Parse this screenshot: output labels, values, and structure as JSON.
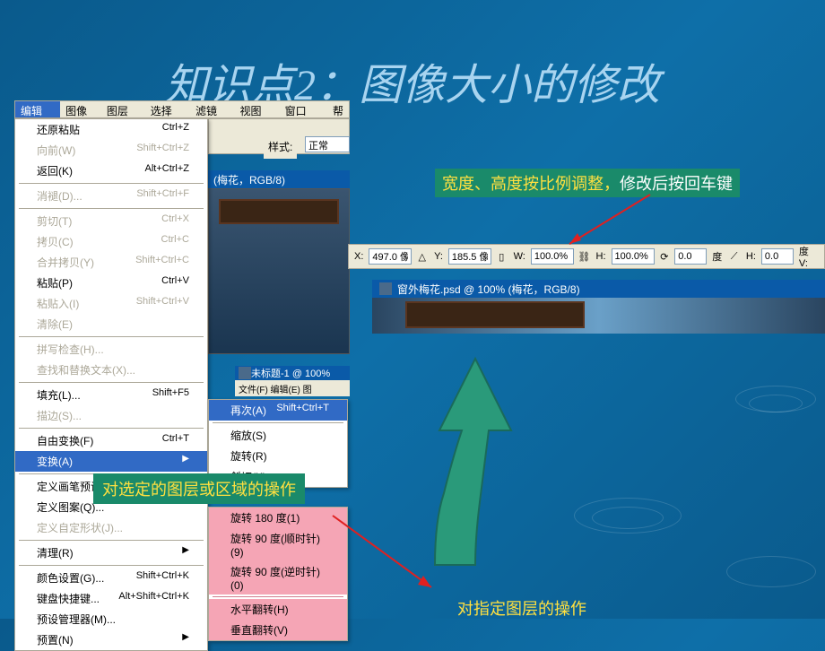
{
  "slide_title": "知识点2：图像大小的修改",
  "menubar": {
    "edit": "编辑(E)",
    "image": "图像(I)",
    "layer": "图层(L)",
    "select": "选择(S)",
    "filter": "滤镜(T)",
    "view": "视图(V)",
    "window": "窗口(W)",
    "help": "帮"
  },
  "edit_menu": {
    "undo_paste": {
      "label": "还原粘贴",
      "shortcut": "Ctrl+Z"
    },
    "forward": {
      "label": "向前(W)",
      "shortcut": "Shift+Ctrl+Z"
    },
    "back": {
      "label": "返回(K)",
      "shortcut": "Alt+Ctrl+Z"
    },
    "fade": {
      "label": "消褪(D)...",
      "shortcut": "Shift+Ctrl+F"
    },
    "cut": {
      "label": "剪切(T)",
      "shortcut": "Ctrl+X"
    },
    "copy": {
      "label": "拷贝(C)",
      "shortcut": "Ctrl+C"
    },
    "copy_merged": {
      "label": "合并拷贝(Y)",
      "shortcut": "Shift+Ctrl+C"
    },
    "paste": {
      "label": "粘贴(P)",
      "shortcut": "Ctrl+V"
    },
    "paste_into": {
      "label": "粘贴入(I)",
      "shortcut": "Shift+Ctrl+V"
    },
    "clear": {
      "label": "清除(E)"
    },
    "spell": {
      "label": "拼写检查(H)..."
    },
    "findreplace": {
      "label": "查找和替换文本(X)..."
    },
    "fill": {
      "label": "填充(L)...",
      "shortcut": "Shift+F5"
    },
    "stroke": {
      "label": "描边(S)..."
    },
    "free_transform": {
      "label": "自由变换(F)",
      "shortcut": "Ctrl+T"
    },
    "transform": {
      "label": "变换(A)"
    },
    "define_brush": {
      "label": "定义画笔预设(B)..."
    },
    "define_pattern": {
      "label": "定义图案(Q)..."
    },
    "define_shape": {
      "label": "定义自定形状(J)..."
    },
    "purge": {
      "label": "清理(R)"
    },
    "color_settings": {
      "label": "颜色设置(G)...",
      "shortcut": "Shift+Ctrl+K"
    },
    "keyboard": {
      "label": "键盘快捷键...",
      "shortcut": "Alt+Shift+Ctrl+K"
    },
    "preset_manager": {
      "label": "预设管理器(M)..."
    },
    "preferences": {
      "label": "预置(N)"
    }
  },
  "transform_submenu": {
    "again": {
      "label": "再次(A)",
      "shortcut": "Shift+Ctrl+T"
    },
    "scale": {
      "label": "缩放(S)"
    },
    "rotate": {
      "label": "旋转(R)"
    },
    "skew": {
      "label": "斜切(K)"
    }
  },
  "rotate_submenu": {
    "r180": "旋转 180 度(1)",
    "r90cw": "旋转 90 度(顺时针)(9)",
    "r90ccw": "旋转 90 度(逆时针)(0)",
    "flip_h": "水平翻转(H)",
    "flip_v": "垂直翻转(V)"
  },
  "toolbar": {
    "style_label": "样式:",
    "style_value": "正常"
  },
  "doc1_title": "(梅花，RGB/8)",
  "doc2_title": "未标题-1 @ 100%",
  "doc2_menubar": "文件(F)  编辑(E)  图",
  "doc3_title": "窗外梅花.psd @ 100% (梅花，RGB/8)",
  "options_bar": {
    "x_label": "X:",
    "x_value": "497.0 像",
    "y_label": "Y:",
    "y_value": "185.5 像",
    "w_label": "W:",
    "w_value": "100.0%",
    "h_label": "H:",
    "h_value": "100.0%",
    "angle_value": "0.0",
    "angle_unit": "度",
    "h2_label": "H:",
    "h2_value": "0.0",
    "v_label": "度 V:"
  },
  "annotation1": {
    "part1": "宽度、高度按比例调整，",
    "part2": "修改后按回车键"
  },
  "annotation2": "对选定的图层或区域的操作",
  "annotation3": "对指定图层的操作",
  "colors": {
    "highlight_bg": "#316ac5",
    "menu_bg": "#ffffff",
    "disabled": "#aca899",
    "annotation_bg": "#1a8a6a",
    "annotation_text": "#ffe040",
    "arrow_fill": "#2a9a7a",
    "submenu2_bg": "#f5a5b5"
  }
}
